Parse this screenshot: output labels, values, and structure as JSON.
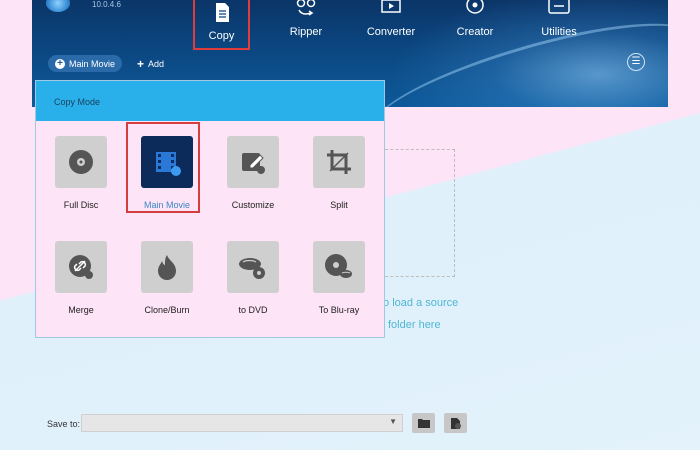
{
  "app": {
    "version": "10.0.4.6"
  },
  "nav": [
    {
      "label": "Copy",
      "icon": "copy-icon"
    },
    {
      "label": "Ripper",
      "icon": "ripper-icon"
    },
    {
      "label": "Converter",
      "icon": "converter-icon"
    },
    {
      "label": "Creator",
      "icon": "creator-icon"
    },
    {
      "label": "Utilities",
      "icon": "utilities-icon"
    }
  ],
  "subbar": {
    "main_movie": "Main Movie",
    "add": "Add"
  },
  "copy_mode": {
    "title": "Copy Mode",
    "modes": [
      {
        "label": "Full Disc",
        "icon": "disc-icon"
      },
      {
        "label": "Main Movie",
        "icon": "film-icon",
        "selected": true
      },
      {
        "label": "Customize",
        "icon": "edit-icon"
      },
      {
        "label": "Split",
        "icon": "crop-icon"
      },
      {
        "label": "Merge",
        "icon": "merge-icon"
      },
      {
        "label": "Clone/Burn",
        "icon": "fire-icon"
      },
      {
        "label": "to DVD",
        "icon": "bluray-to-dvd-icon"
      },
      {
        "label": "To Blu-ray",
        "icon": "dvd-to-bluray-icon"
      }
    ]
  },
  "drop_area": {
    "line1": "to load a source",
    "line2": "folder here"
  },
  "save": {
    "label": "Save to:",
    "value": ""
  },
  "colors": {
    "accent": "#29b0ea",
    "header": "#0b4680",
    "selection": "#d63d3d"
  }
}
